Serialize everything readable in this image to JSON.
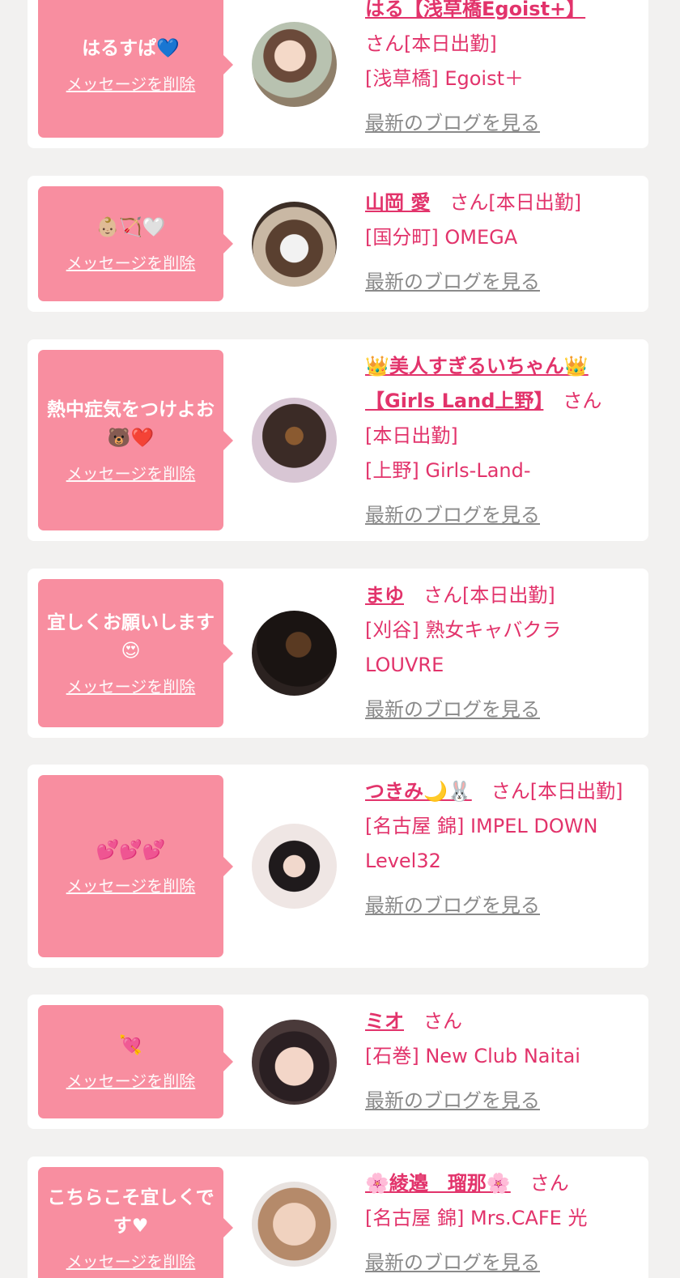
{
  "labels": {
    "delete": "メッセージを削除",
    "blog": "最新のブログを見る",
    "san": "さん",
    "working": "[本日出勤]"
  },
  "colors": {
    "bubble": "#f88ea0",
    "accent": "#e2336b",
    "link_gray": "#8a8a8a",
    "background": "#f2f1f0"
  },
  "cards": [
    {
      "message": "はるすぱ💙",
      "name": "はる【浅草橋Egoist+】",
      "shop": "[浅草橋] Egoist＋",
      "avatar": "avatar-photo"
    },
    {
      "message": "👶🏼🏹🤍",
      "name": "山岡 愛",
      "shop": "[国分町] OMEGA",
      "avatar": "avatar-photo"
    },
    {
      "message": "熱中症気をつけよお🐻❤️",
      "name": "👑美人すぎるいちゃん👑【Girls Land上野】",
      "shop": "[上野] Girls-Land-",
      "avatar": "avatar-photo"
    },
    {
      "message": "宜しくお願いします😍",
      "name": "まゆ",
      "shop": "[刈谷] 熟女キャバクラ LOUVRE",
      "avatar": "avatar-photo"
    },
    {
      "message": "💕💕💕",
      "name": "つきみ🌙🐰",
      "shop": "[名古屋 錦] IMPEL DOWN Level32",
      "avatar": "avatar-photo"
    },
    {
      "message": "💘",
      "name": "ミオ",
      "shop": "[石巻] New Club Naitai",
      "avatar": "avatar-photo"
    },
    {
      "message": "こちらこそ宜しくです♥",
      "name": "🌸綾邉　瑠那🌸",
      "shop": "[名古屋 錦] Mrs.CAFE 光",
      "avatar": "avatar-photo"
    }
  ]
}
